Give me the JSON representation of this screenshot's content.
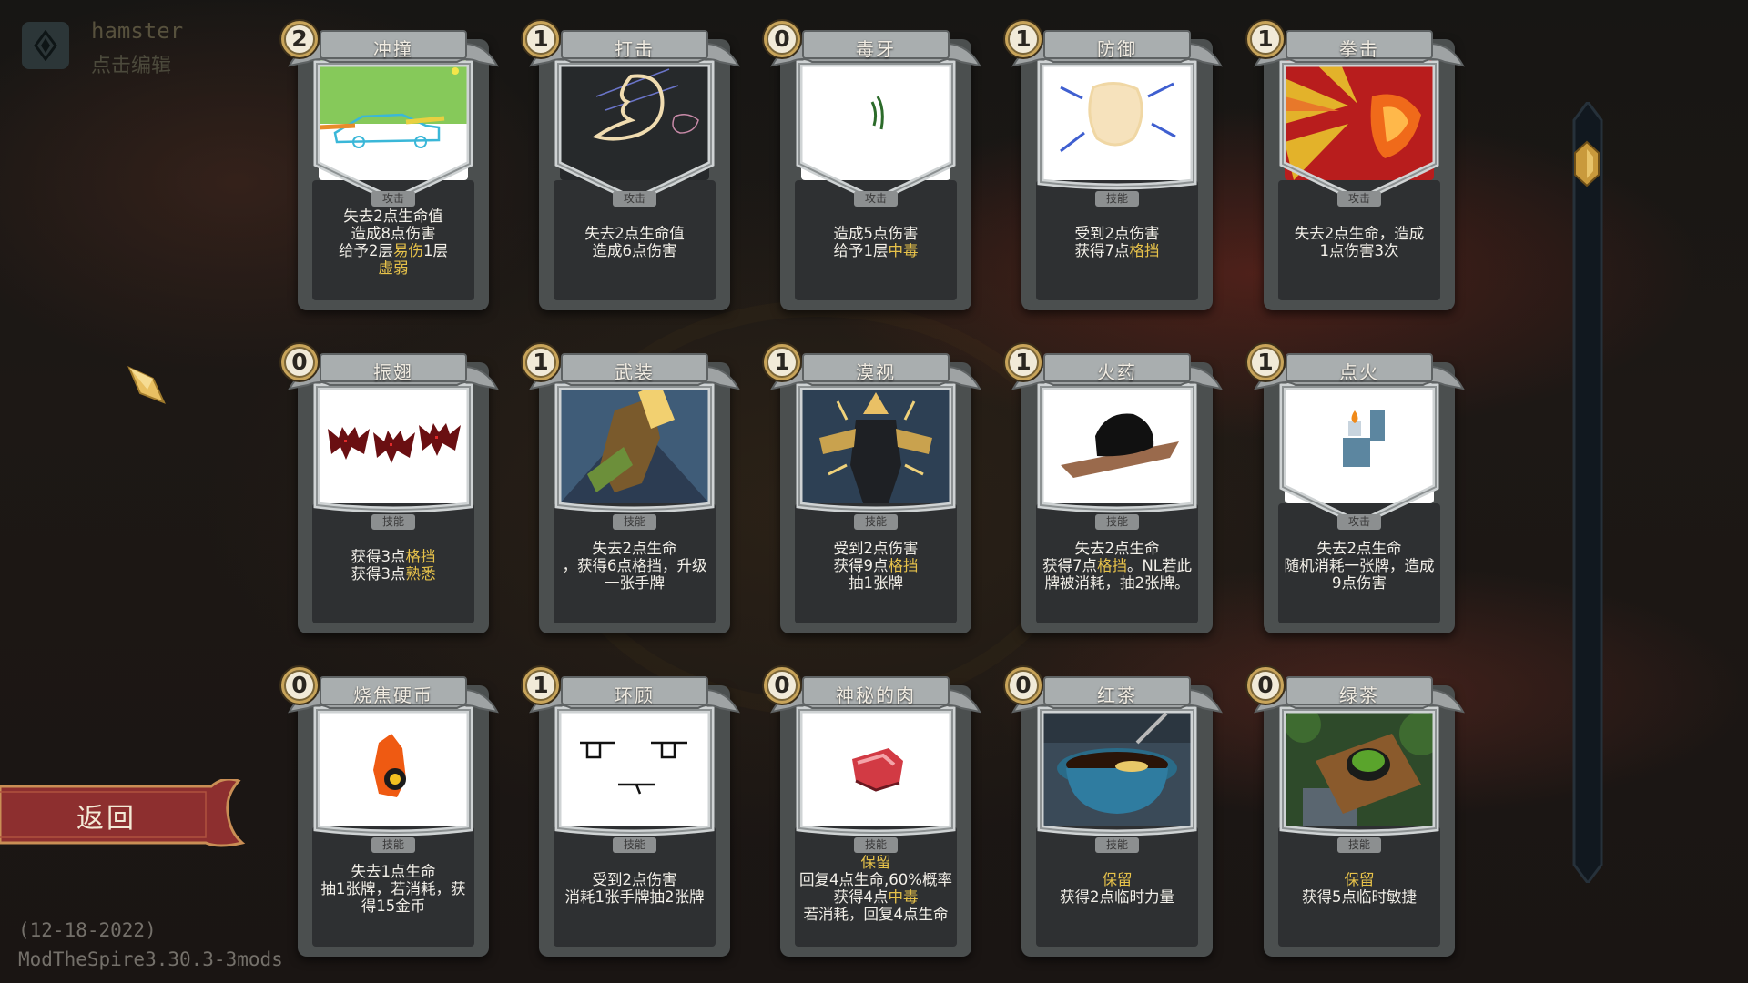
{
  "profile": {
    "name": "hamster",
    "edit_hint": "点击编辑"
  },
  "back_button": {
    "label": "返回"
  },
  "footer": {
    "date": "(12-18-2022)",
    "version": "ModTheSpire3.30.3-3mods"
  },
  "colors": {
    "keyword": "#e7c24a",
    "back_button": "#8d2f2f",
    "card_body": "#4b4f4f"
  },
  "cards": [
    {
      "cost": "2",
      "name": "冲撞",
      "type": "攻击",
      "art": "car-crash-doodle",
      "shape": "attack",
      "desc": [
        [
          "失去2点生命值"
        ],
        [
          "造成8点伤害"
        ],
        [
          "给予2层",
          {
            "kw": "易伤"
          },
          "1层"
        ],
        [
          {
            "kw": "虚弱"
          }
        ]
      ]
    },
    {
      "cost": "1",
      "name": "打击",
      "type": "攻击",
      "art": "fist-doodle",
      "shape": "attack",
      "desc": [
        [
          "失去2点生命值"
        ],
        [
          "造成6点伤害"
        ]
      ]
    },
    {
      "cost": "0",
      "name": "毒牙",
      "type": "攻击",
      "art": "fang-doodle",
      "shape": "attack",
      "desc": [
        [
          "造成5点伤害"
        ],
        [
          "给予1层",
          {
            "kw": "中毒"
          }
        ]
      ]
    },
    {
      "cost": "1",
      "name": "防御",
      "type": "技能",
      "art": "defend-doodle",
      "shape": "skill",
      "desc": [
        [
          "受到2点伤害"
        ],
        [
          "获得7点",
          {
            "kw": "格挡"
          }
        ]
      ]
    },
    {
      "cost": "1",
      "name": "拳击",
      "type": "攻击",
      "art": "punch-burst",
      "shape": "attack",
      "desc": [
        [
          "失去2点生命，造成"
        ],
        [
          "1点伤害3次"
        ]
      ]
    },
    {
      "cost": "0",
      "name": "振翅",
      "type": "技能",
      "art": "pixel-bats",
      "shape": "skill",
      "desc": [
        [
          "获得3点",
          {
            "kw": "格挡"
          }
        ],
        [
          "获得3点",
          {
            "kw": "熟悉"
          }
        ]
      ]
    },
    {
      "cost": "1",
      "name": "武装",
      "type": "技能",
      "art": "armaments-art",
      "shape": "skill",
      "desc": [
        [
          "失去2点生命"
        ],
        [
          "，获得6点格挡，升级"
        ],
        [
          "一张手牌"
        ]
      ]
    },
    {
      "cost": "1",
      "name": "漠视",
      "type": "技能",
      "art": "shrug-art",
      "shape": "skill",
      "desc": [
        [
          "受到2点伤害"
        ],
        [
          "获得9点",
          {
            "kw": "格挡"
          }
        ],
        [
          "抽1张牌"
        ]
      ]
    },
    {
      "cost": "1",
      "name": "火药",
      "type": "技能",
      "art": "gunpowder-doodle",
      "shape": "skill",
      "desc": [
        [
          "失去2点生命"
        ],
        [
          "获得7点",
          {
            "kw": "格挡"
          },
          "。NL若此"
        ],
        [
          "牌被消耗，抽2张牌。"
        ]
      ]
    },
    {
      "cost": "1",
      "name": "点火",
      "type": "攻击",
      "art": "lighter-doodle",
      "shape": "attack",
      "desc": [
        [
          "失去2点生命"
        ],
        [
          "随机消耗一张牌，造成"
        ],
        [
          "9点伤害"
        ]
      ]
    },
    {
      "cost": "0",
      "name": "烧焦硬币",
      "type": "技能",
      "art": "burnt-coin",
      "shape": "skill",
      "desc": [
        [
          "失去1点生命"
        ],
        [
          "抽1张牌，若消耗，获"
        ],
        [
          "得15金币"
        ]
      ]
    },
    {
      "cost": "1",
      "name": "环顾",
      "type": "技能",
      "art": "smug-face",
      "shape": "skill",
      "desc": [
        [
          "受到2点伤害"
        ],
        [
          "消耗1张手牌抽2张牌"
        ]
      ]
    },
    {
      "cost": "0",
      "name": "神秘的肉",
      "type": "技能",
      "art": "pixel-meat",
      "shape": "skill",
      "desc": [
        [
          {
            "kw": "保留"
          }
        ],
        [
          "回复4点生命,60%概率"
        ],
        [
          "获得4点",
          {
            "kw": "中毒"
          }
        ],
        [
          "若消耗，回复4点生命"
        ]
      ]
    },
    {
      "cost": "0",
      "name": "红茶",
      "type": "技能",
      "art": "black-tea",
      "shape": "skill",
      "desc": [
        [
          {
            "kw": "保留"
          }
        ],
        [
          "获得2点临时力量"
        ]
      ]
    },
    {
      "cost": "0",
      "name": "绿茶",
      "type": "技能",
      "art": "green-tea",
      "shape": "skill",
      "desc": [
        [
          {
            "kw": "保留"
          }
        ],
        [
          "获得5点临时敏捷"
        ]
      ]
    }
  ]
}
